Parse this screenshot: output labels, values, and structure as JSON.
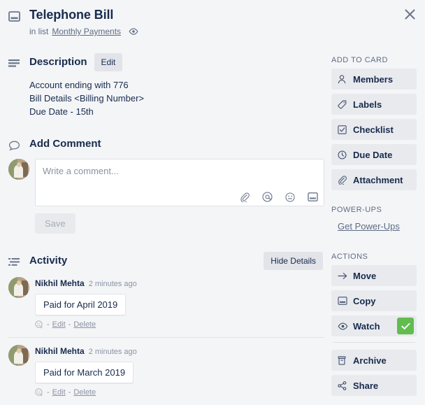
{
  "window": {
    "close_label": "×",
    "accent_green": "#61bd4f",
    "background": "#f4f5f7"
  },
  "header": {
    "card_icon": "card-icon",
    "title": "Telephone Bill",
    "in_list_prefix": "in list",
    "list_name": "Monthly Payments",
    "watch_eye_icon": "eye-icon"
  },
  "description": {
    "icon": "description-lines-icon",
    "heading": "Description",
    "edit_label": "Edit",
    "lines": [
      "Account ending with 776",
      "Bill Details <Billing Number>",
      "Due Date - 15th"
    ]
  },
  "comment": {
    "icon": "comment-bubble-icon",
    "heading": "Add Comment",
    "placeholder": "Write a comment...",
    "value": "",
    "save_label": "Save",
    "toolbar_icons": [
      "attachment-icon",
      "mention-icon",
      "emoji-icon",
      "card-icon"
    ]
  },
  "activity": {
    "icon": "activity-list-icon",
    "heading": "Activity",
    "hide_details_label": "Hide Details",
    "items": [
      {
        "author": "Nikhil Mehta",
        "time": "2 minutes ago",
        "text": "Paid for April 2019",
        "edit_label": "Edit",
        "delete_label": "Delete",
        "separator_dash": "-"
      },
      {
        "author": "Nikhil Mehta",
        "time": "2 minutes ago",
        "text": "Paid for March 2019",
        "edit_label": "Edit",
        "delete_label": "Delete",
        "separator_dash": "-"
      }
    ]
  },
  "sidebar": {
    "add_to_card_label": "ADD TO CARD",
    "add_to_card_items": [
      {
        "label": "Members",
        "icon": "person-icon"
      },
      {
        "label": "Labels",
        "icon": "tag-icon"
      },
      {
        "label": "Checklist",
        "icon": "checkbox-icon"
      },
      {
        "label": "Due Date",
        "icon": "clock-icon"
      },
      {
        "label": "Attachment",
        "icon": "attachment-icon"
      }
    ],
    "powerups_label": "POWER-UPS",
    "powerups_link": "Get Power-Ups",
    "actions_label": "ACTIONS",
    "actions_items": [
      {
        "label": "Move",
        "icon": "arrow-right-icon",
        "checked": false
      },
      {
        "label": "Copy",
        "icon": "card-icon",
        "checked": false
      },
      {
        "label": "Watch",
        "icon": "eye-icon",
        "checked": true
      }
    ],
    "actions_items_secondary": [
      {
        "label": "Archive",
        "icon": "archive-icon",
        "checked": false
      },
      {
        "label": "Share",
        "icon": "share-icon",
        "checked": false
      }
    ]
  }
}
